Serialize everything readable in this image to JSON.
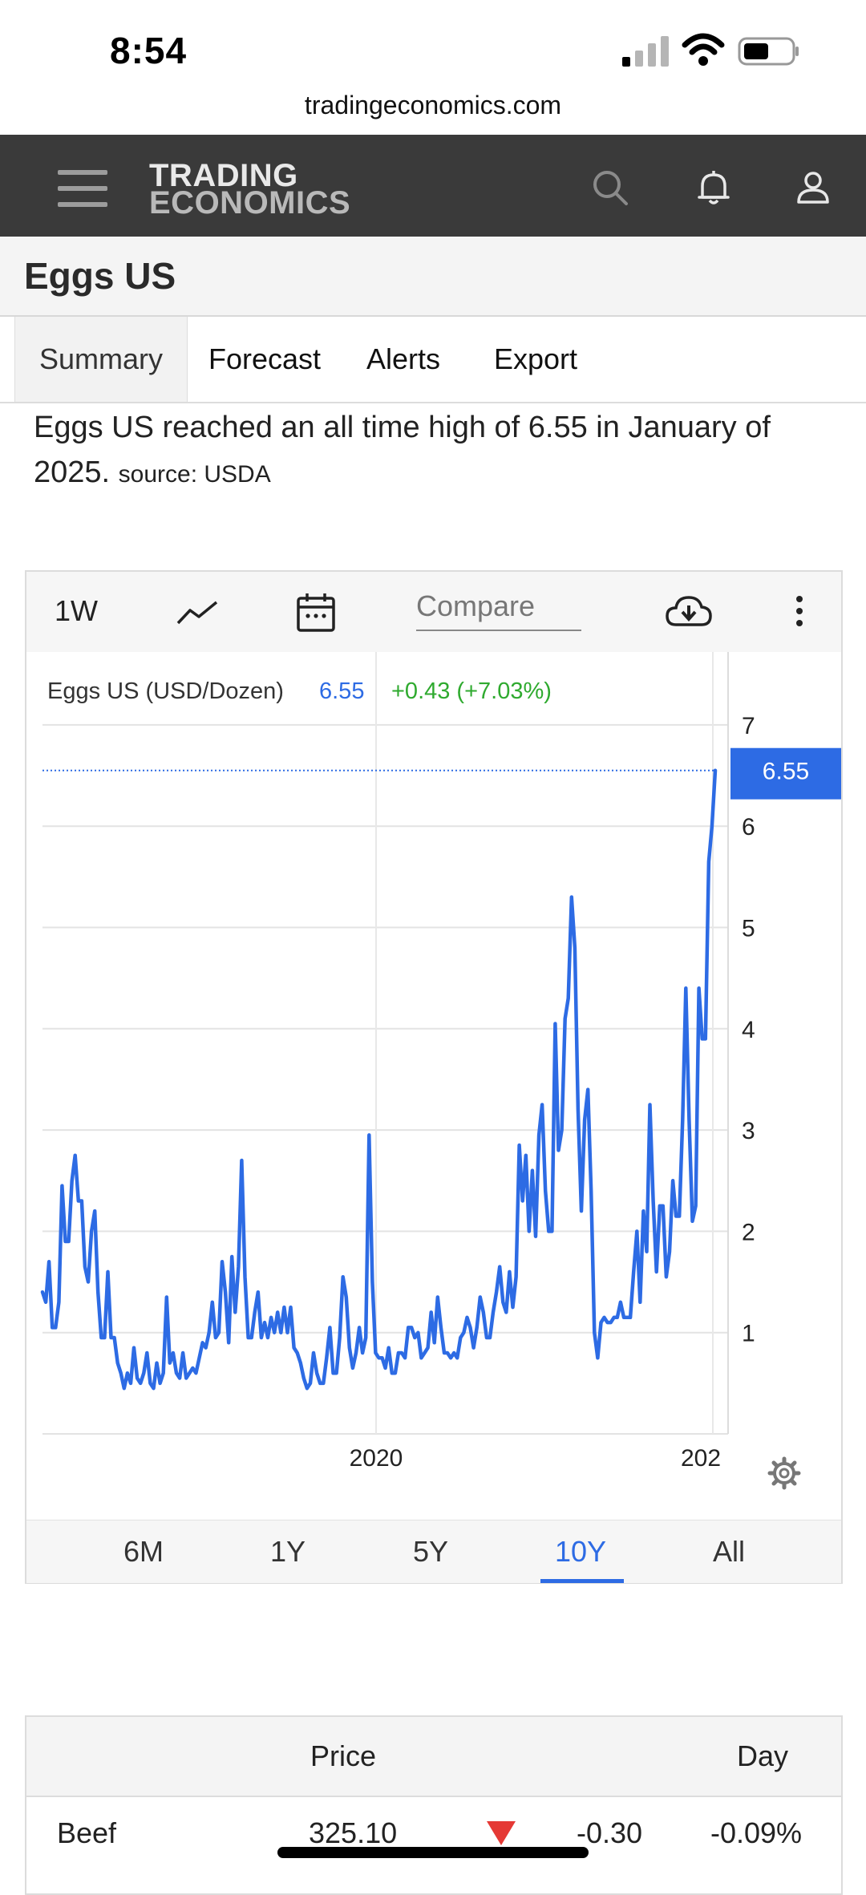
{
  "status": {
    "time": "8:54"
  },
  "browser": {
    "url": "tradingeconomics.com"
  },
  "header": {
    "logo_line1": "TRADING",
    "logo_line2": "ECONOMICS"
  },
  "page": {
    "title": "Eggs US"
  },
  "tabs": [
    {
      "label": "Summary",
      "active": true
    },
    {
      "label": "Forecast"
    },
    {
      "label": "Alerts"
    },
    {
      "label": "Export"
    }
  ],
  "description": {
    "text": "Eggs US reached an all time high of 6.55 in January of 2025.",
    "source": "source: USDA"
  },
  "toolbar": {
    "interval": "1W",
    "compare_placeholder": "Compare"
  },
  "legend": {
    "name": "Eggs US (USD/Dozen)",
    "value": "6.55",
    "change": "+0.43 (+7.03%)"
  },
  "colors": {
    "line": "#2d6be4",
    "up": "#2faa2f",
    "down": "#e53935",
    "header_bg": "#3a3a3a"
  },
  "chart_data": {
    "type": "line",
    "series": [
      {
        "name": "Eggs US (USD/Dozen)",
        "x_start": 2015.1,
        "x_end": 2025.07,
        "values": [
          1.4,
          1.3,
          1.7,
          1.05,
          1.05,
          1.3,
          2.45,
          1.9,
          1.9,
          2.5,
          2.75,
          2.3,
          2.3,
          1.65,
          1.5,
          2.0,
          2.2,
          1.4,
          0.95,
          0.95,
          1.6,
          0.95,
          0.95,
          0.7,
          0.6,
          0.45,
          0.6,
          0.5,
          0.85,
          0.55,
          0.5,
          0.6,
          0.8,
          0.5,
          0.45,
          0.7,
          0.5,
          0.6,
          1.35,
          0.7,
          0.8,
          0.6,
          0.55,
          0.8,
          0.55,
          0.6,
          0.65,
          0.6,
          0.75,
          0.9,
          0.85,
          1.0,
          1.3,
          0.95,
          1.0,
          1.7,
          1.4,
          0.9,
          1.75,
          1.2,
          1.65,
          2.7,
          1.55,
          0.95,
          0.95,
          1.2,
          1.4,
          0.95,
          1.1,
          0.95,
          1.15,
          1.0,
          1.2,
          1.0,
          1.25,
          1.0,
          1.25,
          0.85,
          0.8,
          0.7,
          0.55,
          0.45,
          0.5,
          0.8,
          0.6,
          0.5,
          0.5,
          0.75,
          1.05,
          0.6,
          0.6,
          0.95,
          1.55,
          1.35,
          0.85,
          0.65,
          0.8,
          1.05,
          0.8,
          0.95,
          2.95,
          1.5,
          0.8,
          0.75,
          0.75,
          0.65,
          0.85,
          0.6,
          0.6,
          0.8,
          0.8,
          0.75,
          1.05,
          1.05,
          0.95,
          1.0,
          0.75,
          0.8,
          0.85,
          1.2,
          0.9,
          1.35,
          1.05,
          0.8,
          0.8,
          0.75,
          0.8,
          0.75,
          0.95,
          1.0,
          1.15,
          1.05,
          0.85,
          1.05,
          1.35,
          1.2,
          0.95,
          0.95,
          1.2,
          1.4,
          1.65,
          1.3,
          1.2,
          1.6,
          1.25,
          1.55,
          2.85,
          2.3,
          2.75,
          2.0,
          2.6,
          1.95,
          2.95,
          3.25,
          2.4,
          2.0,
          2.0,
          4.05,
          2.8,
          3.0,
          4.1,
          4.3,
          5.3,
          4.8,
          3.2,
          2.2,
          3.1,
          3.4,
          2.4,
          1.0,
          0.75,
          1.1,
          1.15,
          1.1,
          1.1,
          1.15,
          1.15,
          1.3,
          1.15,
          1.15,
          1.15,
          1.6,
          2.0,
          1.3,
          2.2,
          1.8,
          3.25,
          2.3,
          1.6,
          2.25,
          2.25,
          1.55,
          1.8,
          2.5,
          2.15,
          2.15,
          3.1,
          4.4,
          3.1,
          2.1,
          2.25,
          4.4,
          3.9,
          3.9,
          5.65,
          6.0,
          6.55
        ]
      }
    ],
    "x_ticks": [
      "2020",
      "202"
    ],
    "y_ticks": [
      1,
      2,
      3,
      4,
      5,
      6,
      7
    ],
    "ylim": [
      0,
      7.5
    ],
    "last_value_label": "6.55",
    "grid": true
  },
  "ranges": [
    {
      "label": "6M"
    },
    {
      "label": "1Y"
    },
    {
      "label": "5Y"
    },
    {
      "label": "10Y",
      "active": true
    },
    {
      "label": "All"
    }
  ],
  "table": {
    "headers": [
      "Price",
      "Day"
    ],
    "rows": [
      {
        "name": "Beef",
        "price": "325.10",
        "change": "-0.30",
        "pct": "-0.09%",
        "direction": "down"
      }
    ]
  }
}
